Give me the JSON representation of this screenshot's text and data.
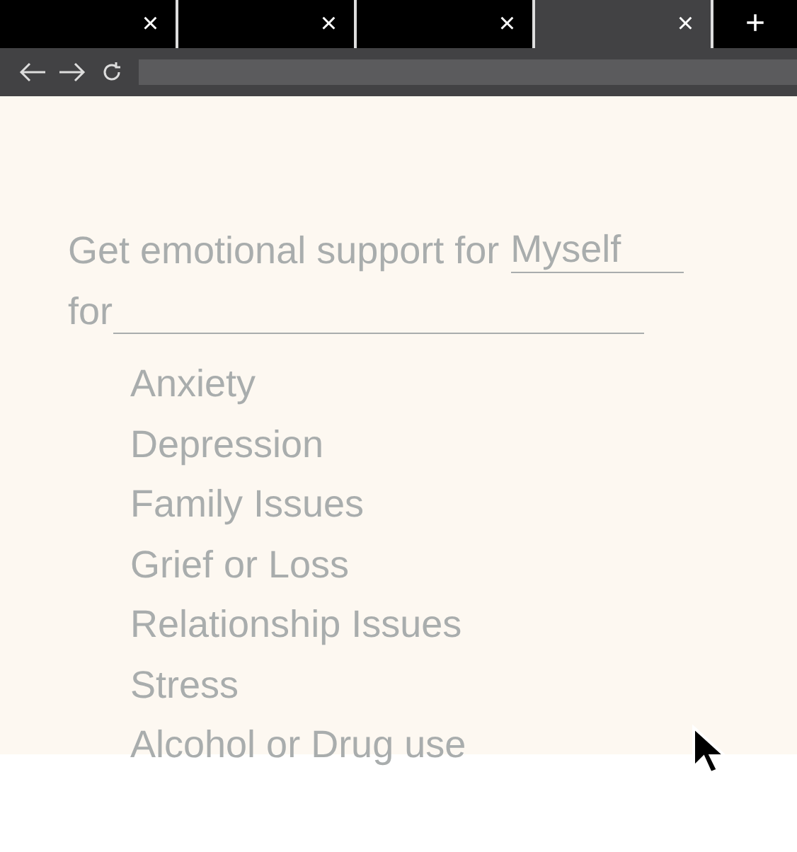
{
  "tabs": [
    {
      "selected": false
    },
    {
      "selected": false
    },
    {
      "selected": false
    },
    {
      "selected": true
    }
  ],
  "tab_close": "×",
  "new_tab": "+",
  "form": {
    "prompt": "Get emotional support for",
    "who": "Myself",
    "for_label": "for"
  },
  "topics": [
    "Anxiety",
    "Depression",
    "Family Issues",
    "Grief or Loss",
    "Relationship Issues",
    "Stress",
    "Alcohol or Drug use"
  ]
}
